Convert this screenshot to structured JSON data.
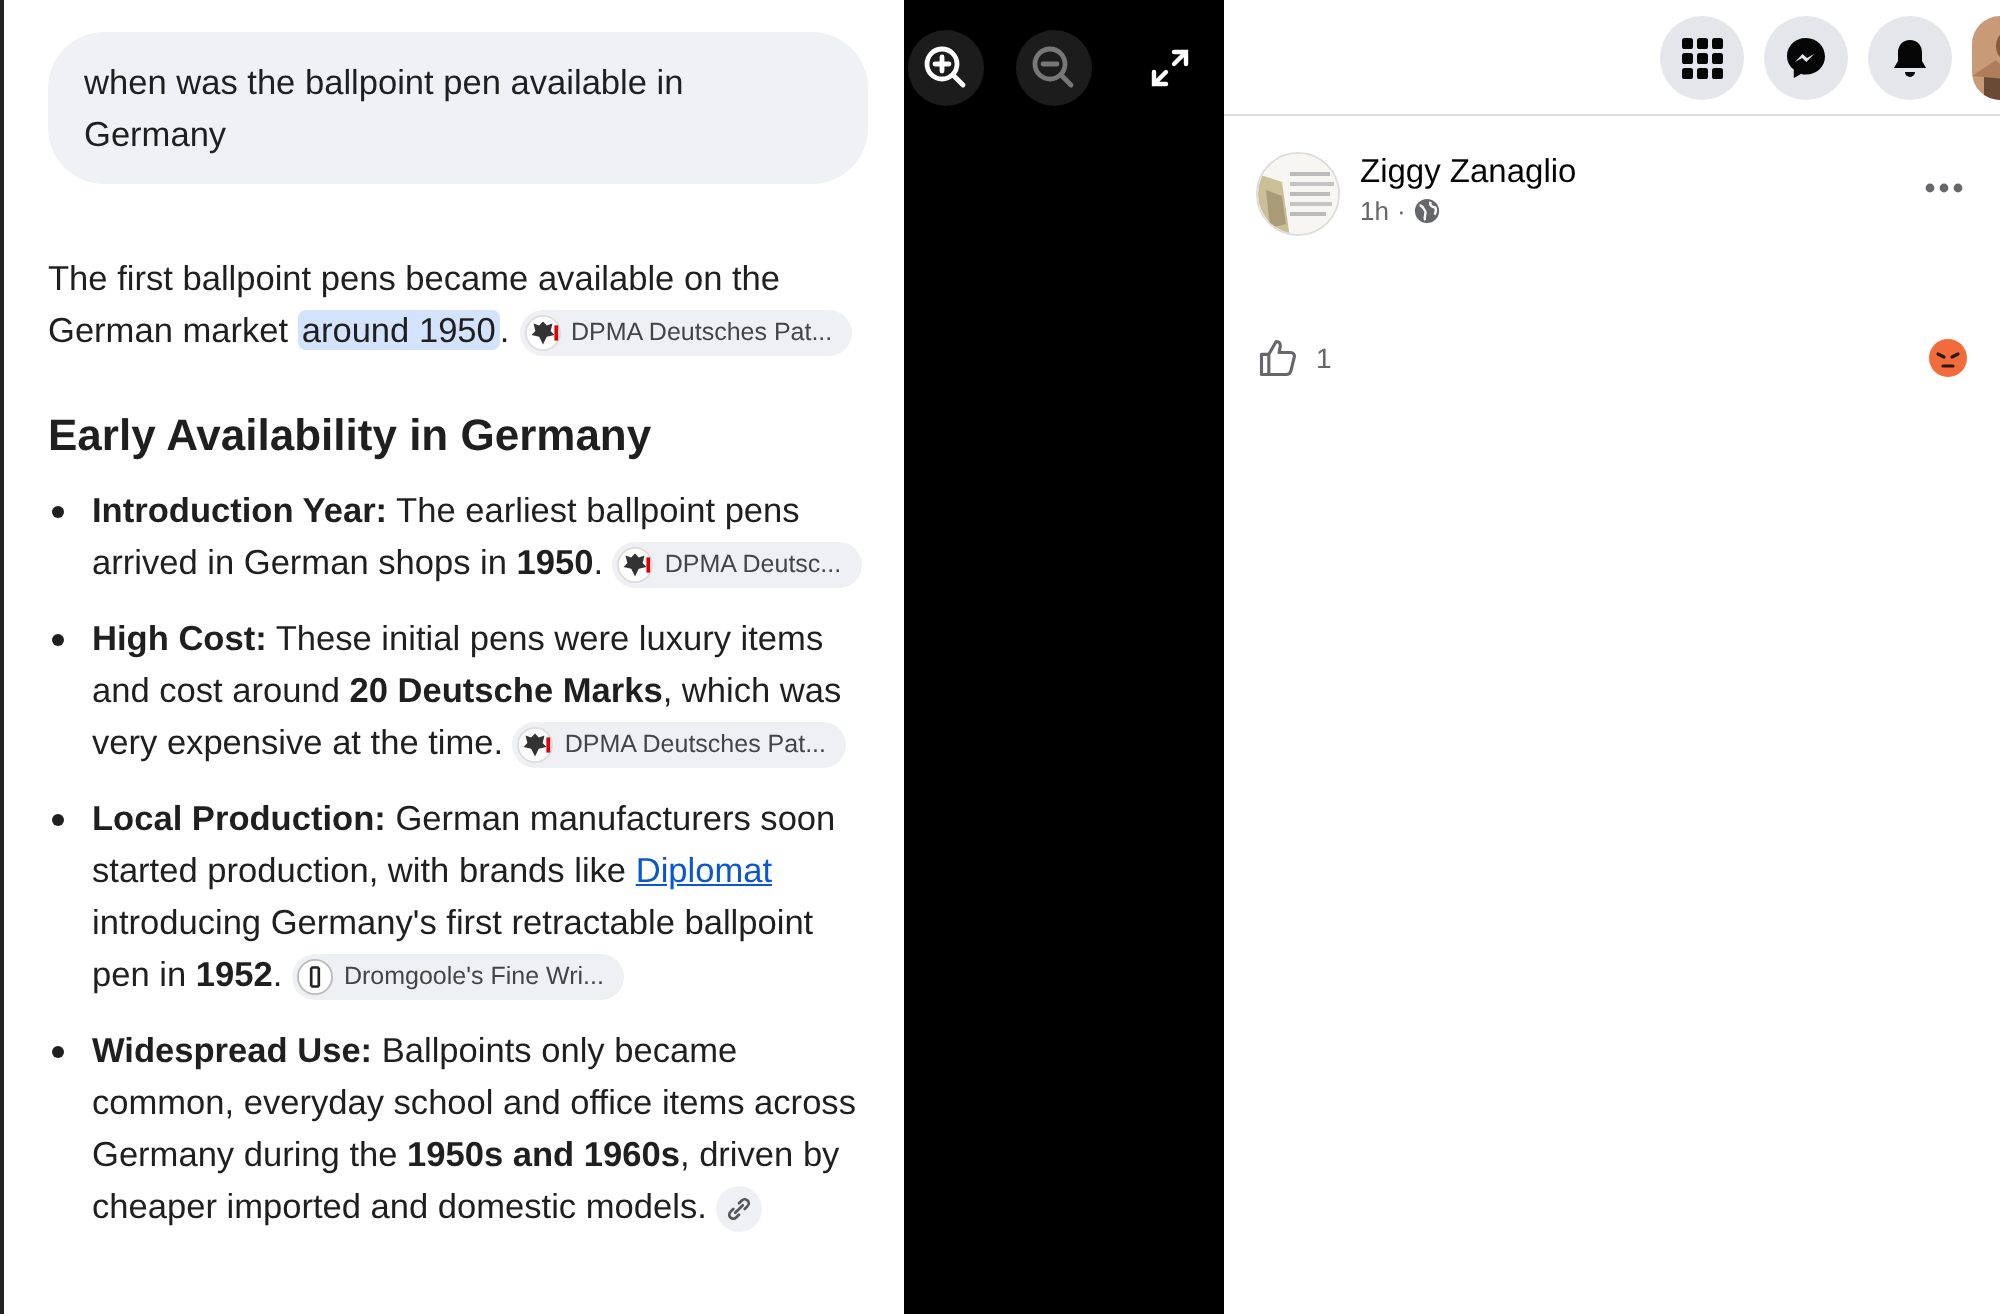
{
  "viewer": {
    "controls": [
      {
        "kind": "zoom_in",
        "disabled": false
      },
      {
        "kind": "zoom_out",
        "disabled": true
      },
      {
        "kind": "fullscreen",
        "disabled": false
      }
    ]
  },
  "answer": {
    "question": "when was the ballpoint pen available in Germany",
    "intro": {
      "before": "The first ballpoint pens became available on the German market ",
      "highlight": "around 1950",
      "after": ".",
      "source": {
        "kind": "eagle",
        "label": "DPMA Deutsches Pat..."
      }
    },
    "heading": "Early Availability in Germany",
    "bullets": [
      {
        "parts": [
          {
            "kind": "text",
            "text": "**Introduction Year:** The earliest ballpoint pens arrived in German shops in **1950**."
          }
        ],
        "source": {
          "kind": "eagle",
          "label": "DPMA Deutsc..."
        }
      },
      {
        "parts": [
          {
            "kind": "text",
            "text": "**High Cost:** These initial pens were luxury items and cost around **20 Deutsche Marks**, which was very expensive at the time."
          }
        ],
        "source": {
          "kind": "eagle",
          "label": "DPMA Deutsches Pat..."
        }
      },
      {
        "parts": [
          {
            "kind": "text",
            "text": "**Local Production:** German manufacturers soon started production, with brands like "
          },
          {
            "kind": "link",
            "text": "Diplomat"
          },
          {
            "kind": "text",
            "text": " introducing Germany's first retractable ballpoint pen in **1952**."
          }
        ],
        "source": {
          "kind": "pen",
          "label": "Dromgoole's Fine Wri..."
        }
      },
      {
        "parts": [
          {
            "kind": "text",
            "text": "**Widespread Use:** Ballpoints only became common, everyday school and office items across Germany during the **1950s and 1960s**, driven by cheaper imported and domestic models."
          }
        ],
        "source": {
          "kind": "link"
        }
      }
    ]
  },
  "topbar": {
    "buttons": [
      {
        "kind": "menu"
      },
      {
        "kind": "messenger"
      },
      {
        "kind": "notifications"
      }
    ]
  },
  "post": {
    "author": "Ziggy Zanaglio",
    "time": "1h",
    "separator": "·",
    "like_count": "1"
  }
}
